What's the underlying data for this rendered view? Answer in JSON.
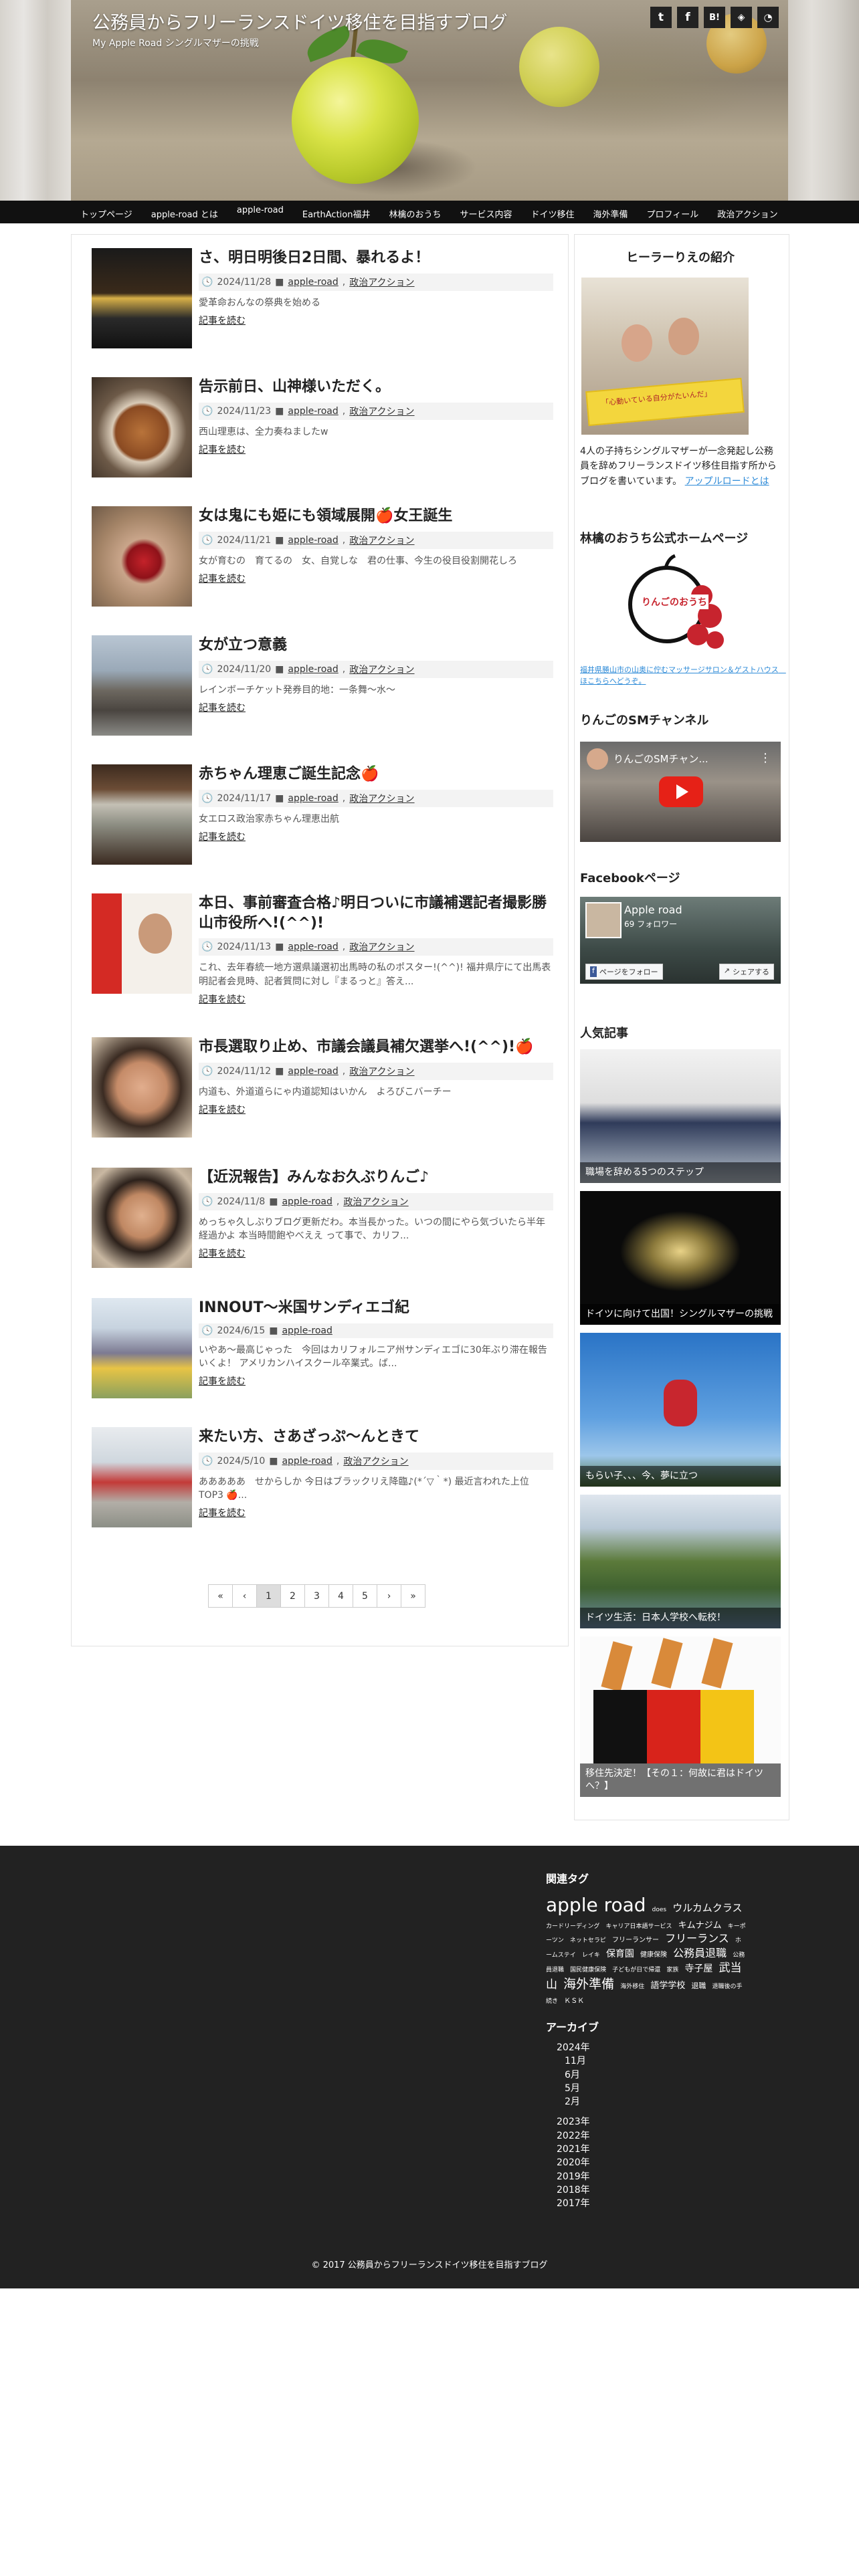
{
  "site": {
    "title": "公務員からフリーランスドイツ移住を目指すブログ",
    "subtitle": "My Apple Road シングルマザーの挑戦"
  },
  "social": [
    "twitter-icon",
    "facebook-icon",
    "hatena-icon",
    "feedly-icon",
    "rss-icon"
  ],
  "nav": [
    "トップページ",
    "apple-road とは",
    "apple-road",
    "EarthAction福井",
    "林檎のおうち",
    "サービス内容",
    "ドイツ移住",
    "海外準備",
    "プロフィール",
    "政治アクション"
  ],
  "posts": [
    {
      "title": "さ、明日明後日2日間、暴れるよ！",
      "date": "2024/11/28",
      "cat1": "apple-road",
      "cat2": "政治アクション",
      "excerpt": "愛革命おんなの祭典を始める",
      "more": "記事を読む"
    },
    {
      "title": "告示前日、山神様いただく。",
      "date": "2024/11/23",
      "cat1": "apple-road",
      "cat2": "政治アクション",
      "excerpt": "西山理恵は、全力奏ねましたw",
      "more": "記事を読む"
    },
    {
      "title": "女は鬼にも姫にも領域展開🍎女王誕生",
      "date": "2024/11/21",
      "cat1": "apple-road",
      "cat2": "政治アクション",
      "excerpt": "女が育むの　育てるの　女、自覚しな　君の仕事、今生の役目役割開花しろ",
      "more": "記事を読む"
    },
    {
      "title": "女が立つ意義",
      "date": "2024/11/20",
      "cat1": "apple-road",
      "cat2": "政治アクション",
      "excerpt": "レインボーチケット発券目的地：一条舞～水～",
      "more": "記事を読む"
    },
    {
      "title": "赤ちゃん理恵ご誕生記念🍎",
      "date": "2024/11/17",
      "cat1": "apple-road",
      "cat2": "政治アクション",
      "excerpt": "女エロス政治家赤ちゃん理恵出航",
      "more": "記事を読む"
    },
    {
      "title": "本日、事前審査合格♪明日ついに市議補選記者撮影勝山市役所へ!(^^)!",
      "date": "2024/11/13",
      "cat1": "apple-road",
      "cat2": "政治アクション",
      "excerpt": "これ、去年春統一地方選県議選初出馬時の私のポスター!(^^)! 福井県庁にて出馬表明記者会見時、記者質問に対し『まるっと』答え...",
      "more": "記事を読む"
    },
    {
      "title": "市長選取り止め、市議会議員補欠選挙へ!(^^)!🍎",
      "date": "2024/11/12",
      "cat1": "apple-road",
      "cat2": "政治アクション",
      "excerpt": "内道も、外道道らにゃ内道認知はいかん　よろびこバーチー",
      "more": "記事を読む"
    },
    {
      "title": "【近況報告】みんなお久ぶりんご♪",
      "date": "2024/11/8",
      "cat1": "apple-road",
      "cat2": "政治アクション",
      "excerpt": "めっちゃ久しぶりブログ更新だわ。本当長かった。いつの間にやら気づいたら半年経過かよ 本当時間飽やべええ って事で、カリフ...",
      "more": "記事を読む"
    },
    {
      "title": "INNOUT～米国サンディエゴ紀",
      "date": "2024/6/15",
      "cat1": "apple-road",
      "cat2": "",
      "excerpt": "いやあ～最高じゃった　今回はカリフォルニア州サンディエゴに30年ぶり滞在報告いくよ！ アメリカンハイスクール卒業式。ば...",
      "more": "記事を読む"
    },
    {
      "title": "来たい方、さあざっぷ～んときて",
      "date": "2024/5/10",
      "cat1": "apple-road",
      "cat2": "政治アクション",
      "excerpt": "あああああ　せからしか 今日はブラックリえ降臨♪(*´▽｀*) 最近言われた上位TOP3 🍎...",
      "more": "記事を読む"
    }
  ],
  "pagination": [
    "«",
    "‹",
    "1",
    "2",
    "3",
    "4",
    "5",
    "›",
    "»"
  ],
  "sidebar": {
    "profile_title": "ヒーラーりえの紹介",
    "profile_text": "4人の子持ちシングルマザーが一念発起し公務員を辞めフリーランスドイツ移住目指す所からブログを書いています。",
    "profile_link": "アップルロードとは",
    "profile_caption": "「心動いている自分がたいんだ」",
    "home_title": "林檎のおうち公式ホームページ",
    "home_logo_text": "りんごのおうち",
    "home_link": "福井県勝山市の山奥に佇むマッサージサロン＆ゲストハウス　ほこちらへどうぞ。",
    "yt_title": "りんごのSMチャンネル",
    "yt_video_title": "りんごのSMチャン...",
    "fb_title": "Facebookページ",
    "fb_page_name": "Apple road",
    "fb_followers": "69 フォロワー",
    "fb_follow": "ページをフォロー",
    "fb_share": "シェアする",
    "popular_title": "人気記事",
    "popular": [
      "職場を辞める5つのステップ",
      "ドイツに向けて出国！シングルマザーの挑戦",
      "もらい子、、、今、夢に立つ",
      "ドイツ生活：日本人学校へ転校！",
      "移住先決定！【その１：何故に君はドイツへ？】"
    ]
  },
  "footer": {
    "tags_title": "関連タグ",
    "tags": [
      {
        "t": "apple road",
        "s": 28
      },
      {
        "t": "does",
        "s": 9
      },
      {
        "t": "ウルカムクラス",
        "s": 15
      },
      {
        "t": "カードリーディング",
        "s": 9
      },
      {
        "t": "キャリア日本語サービス",
        "s": 9
      },
      {
        "t": "キムナジム",
        "s": 13
      },
      {
        "t": "キーポーツン",
        "s": 9
      },
      {
        "t": "ネットセラピ",
        "s": 9
      },
      {
        "t": "フリーランサー",
        "s": 10
      },
      {
        "t": "フリーランス",
        "s": 16
      },
      {
        "t": "ホームステイ",
        "s": 9
      },
      {
        "t": "レイキ",
        "s": 9
      },
      {
        "t": "保育園",
        "s": 14
      },
      {
        "t": "健康保険",
        "s": 10
      },
      {
        "t": "公務員退職",
        "s": 16
      },
      {
        "t": "公務員退職",
        "s": 9
      },
      {
        "t": "国民健康保険",
        "s": 9
      },
      {
        "t": "子どもが日で帰還",
        "s": 9
      },
      {
        "t": "家族",
        "s": 9
      },
      {
        "t": "寺子屋",
        "s": 14
      },
      {
        "t": "武当山",
        "s": 17
      },
      {
        "t": "海外準備",
        "s": 19
      },
      {
        "t": "海外移住",
        "s": 9
      },
      {
        "t": "語学学校",
        "s": 13
      },
      {
        "t": "退職",
        "s": 11
      },
      {
        "t": "退職後の手続き",
        "s": 9
      },
      {
        "t": "ＫＳＫ",
        "s": 10
      }
    ],
    "archive_title": "アーカイブ",
    "archive_2024": "2024年",
    "archive_months": [
      "11月",
      "6月",
      "5月",
      "2月"
    ],
    "archive_years": [
      "2023年",
      "2022年",
      "2021年",
      "2020年",
      "2019年",
      "2018年",
      "2017年"
    ],
    "copyright": "© 2017 公務員からフリーランスドイツ移住を目指すブログ"
  }
}
